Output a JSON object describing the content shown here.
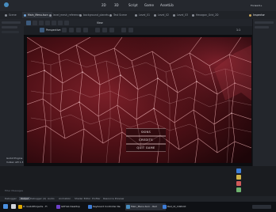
{
  "menubar": {
    "items": [
      "2D",
      "3D",
      "Script",
      "Game",
      "AssetLib"
    ],
    "right_label": "Forward+"
  },
  "tabs": [
    {
      "label": "Scene"
    },
    {
      "label": "Main_Menu.tscn",
      "active": true
    },
    {
      "label": "level_mesh_reference"
    },
    {
      "label": "background_planets"
    },
    {
      "label": "Test Scene"
    },
    {
      "label": "Level_01"
    },
    {
      "label": "Level_02"
    },
    {
      "label": "Level_03"
    },
    {
      "label": "Hexagon_Grid_2D"
    }
  ],
  "inspector_title": "Inspector",
  "toolbar": {
    "view_label": "View",
    "perspective_label": "Perspective",
    "right_label": "1:1"
  },
  "game_menu": {
    "items": [
      "SKINS",
      "CREDITS",
      "QUIT GAME"
    ]
  },
  "console": {
    "lines": [
      "Godot Engine",
      "Vulkan API 1.3"
    ],
    "filter_placeholder": "Filter Messages"
  },
  "bottom_tabs": [
    "Debugger",
    "Output",
    "Debugger (4)",
    "Audio",
    "Animation",
    "Shader Editor",
    "Profiler",
    "Resource Preview"
  ],
  "taskbar": {
    "items": [
      {
        "label": "D: GodotProjects - Fi",
        "color": "#e0a800"
      },
      {
        "label": "GitHub Desktop",
        "color": "#6e40c9"
      },
      {
        "label": "Keyboard Controller Re",
        "color": "#3d7dd8"
      },
      {
        "label": "Main_Menu.tscn - Red",
        "color": "#478cbf"
      },
      {
        "label": "Red_UI_1920.bt",
        "color": "#3d7dd8"
      }
    ]
  }
}
